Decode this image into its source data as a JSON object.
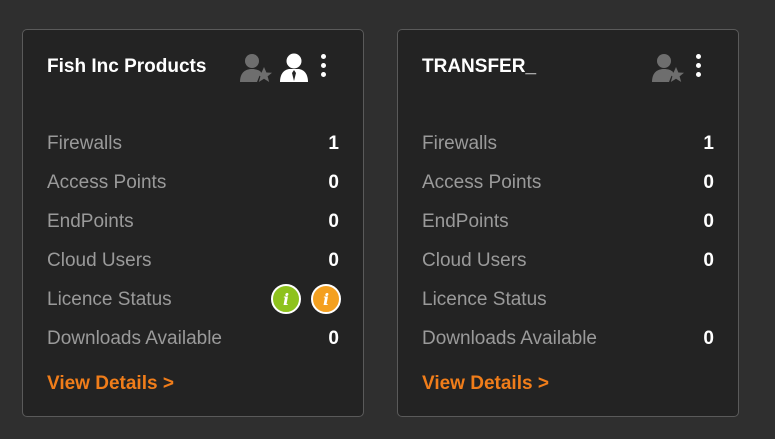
{
  "cards": [
    {
      "title": "Fish Inc Products",
      "icons": [
        "user-star-icon",
        "admin-user-icon",
        "kebab-menu-icon"
      ],
      "rows": [
        {
          "label": "Firewalls",
          "value": "1"
        },
        {
          "label": "Access Points",
          "value": "0"
        },
        {
          "label": "EndPoints",
          "value": "0"
        },
        {
          "label": "Cloud Users",
          "value": "0"
        },
        {
          "label": "Licence Status",
          "value": "",
          "badges": [
            {
              "icon": "info-icon",
              "glyph": "i",
              "color": "#8ec21d"
            },
            {
              "icon": "info-icon",
              "glyph": "i",
              "color": "#f4a020"
            }
          ]
        },
        {
          "label": "Downloads Available",
          "value": "0"
        }
      ],
      "link": "View Details >"
    },
    {
      "title": "TRANSFER_",
      "icons": [
        "user-star-icon",
        "kebab-menu-icon"
      ],
      "rows": [
        {
          "label": "Firewalls",
          "value": "1"
        },
        {
          "label": "Access Points",
          "value": "0"
        },
        {
          "label": "EndPoints",
          "value": "0"
        },
        {
          "label": "Cloud Users",
          "value": "0"
        },
        {
          "label": "Licence Status",
          "value": ""
        },
        {
          "label": "Downloads Available",
          "value": "0"
        }
      ],
      "link": "View Details >"
    }
  ],
  "colors": {
    "background": "#2f2f2f",
    "card": "#232323",
    "label": "#9a9a9a",
    "link": "#f07d1a",
    "icon_muted": "#6e6e6e"
  }
}
